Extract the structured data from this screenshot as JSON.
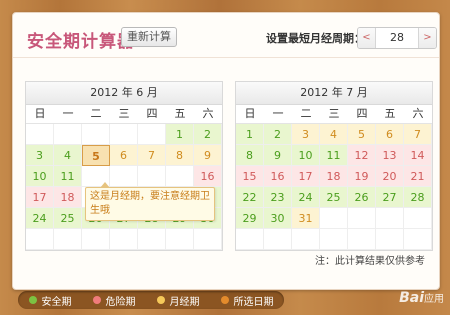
{
  "header": {
    "title": "安全期计算器",
    "recalc_label": "重新计算",
    "setting_label": "设置最短月经周期：",
    "cycle_value": "28",
    "dec_glyph": "<",
    "inc_glyph": ">"
  },
  "weekdays": [
    "日",
    "一",
    "二",
    "三",
    "四",
    "五",
    "六"
  ],
  "calendars": [
    {
      "title": "2012 年 6 月",
      "cells": [
        {
          "d": "",
          "t": "empty"
        },
        {
          "d": "",
          "t": "empty"
        },
        {
          "d": "",
          "t": "empty"
        },
        {
          "d": "",
          "t": "empty"
        },
        {
          "d": "",
          "t": "empty"
        },
        {
          "d": "1",
          "t": "safe"
        },
        {
          "d": "2",
          "t": "safe"
        },
        {
          "d": "3",
          "t": "safe"
        },
        {
          "d": "4",
          "t": "safe"
        },
        {
          "d": "5",
          "t": "selected"
        },
        {
          "d": "6",
          "t": "period"
        },
        {
          "d": "7",
          "t": "period"
        },
        {
          "d": "8",
          "t": "period"
        },
        {
          "d": "9",
          "t": "period"
        },
        {
          "d": "10",
          "t": "safe"
        },
        {
          "d": "11",
          "t": "safe"
        },
        {
          "d": "",
          "t": "empty"
        },
        {
          "d": "",
          "t": "empty"
        },
        {
          "d": "",
          "t": "empty"
        },
        {
          "d": "",
          "t": "empty"
        },
        {
          "d": "16",
          "t": "danger"
        },
        {
          "d": "17",
          "t": "danger"
        },
        {
          "d": "18",
          "t": "danger"
        },
        {
          "d": "",
          "t": "empty"
        },
        {
          "d": "",
          "t": "empty"
        },
        {
          "d": "",
          "t": "empty"
        },
        {
          "d": "",
          "t": "empty"
        },
        {
          "d": "23",
          "t": "safe"
        },
        {
          "d": "24",
          "t": "safe"
        },
        {
          "d": "25",
          "t": "safe"
        },
        {
          "d": "26",
          "t": "safe"
        },
        {
          "d": "27",
          "t": "safe"
        },
        {
          "d": "28",
          "t": "safe"
        },
        {
          "d": "29",
          "t": "safe"
        },
        {
          "d": "30",
          "t": "safe"
        },
        {
          "d": "",
          "t": "empty"
        },
        {
          "d": "",
          "t": "empty"
        },
        {
          "d": "",
          "t": "empty"
        },
        {
          "d": "",
          "t": "empty"
        },
        {
          "d": "",
          "t": "empty"
        },
        {
          "d": "",
          "t": "empty"
        },
        {
          "d": "",
          "t": "empty"
        }
      ]
    },
    {
      "title": "2012 年 7 月",
      "cells": [
        {
          "d": "1",
          "t": "safe"
        },
        {
          "d": "2",
          "t": "safe"
        },
        {
          "d": "3",
          "t": "period"
        },
        {
          "d": "4",
          "t": "period"
        },
        {
          "d": "5",
          "t": "period"
        },
        {
          "d": "6",
          "t": "period"
        },
        {
          "d": "7",
          "t": "period"
        },
        {
          "d": "8",
          "t": "safe"
        },
        {
          "d": "9",
          "t": "safe"
        },
        {
          "d": "10",
          "t": "safe"
        },
        {
          "d": "11",
          "t": "safe"
        },
        {
          "d": "12",
          "t": "danger"
        },
        {
          "d": "13",
          "t": "danger"
        },
        {
          "d": "14",
          "t": "danger"
        },
        {
          "d": "15",
          "t": "danger"
        },
        {
          "d": "16",
          "t": "danger"
        },
        {
          "d": "17",
          "t": "danger"
        },
        {
          "d": "18",
          "t": "danger"
        },
        {
          "d": "19",
          "t": "danger"
        },
        {
          "d": "20",
          "t": "danger"
        },
        {
          "d": "21",
          "t": "danger"
        },
        {
          "d": "22",
          "t": "safe"
        },
        {
          "d": "23",
          "t": "safe"
        },
        {
          "d": "24",
          "t": "safe"
        },
        {
          "d": "25",
          "t": "safe"
        },
        {
          "d": "26",
          "t": "safe"
        },
        {
          "d": "27",
          "t": "safe"
        },
        {
          "d": "28",
          "t": "safe"
        },
        {
          "d": "29",
          "t": "safe"
        },
        {
          "d": "30",
          "t": "safe"
        },
        {
          "d": "31",
          "t": "period"
        },
        {
          "d": "",
          "t": "empty"
        },
        {
          "d": "",
          "t": "empty"
        },
        {
          "d": "",
          "t": "empty"
        },
        {
          "d": "",
          "t": "empty"
        },
        {
          "d": "",
          "t": "empty"
        },
        {
          "d": "",
          "t": "empty"
        },
        {
          "d": "",
          "t": "empty"
        },
        {
          "d": "",
          "t": "empty"
        },
        {
          "d": "",
          "t": "empty"
        },
        {
          "d": "",
          "t": "empty"
        },
        {
          "d": "",
          "t": "empty"
        }
      ]
    }
  ],
  "tooltip": "这是月经期，要注意经期卫生哦",
  "note": "注：此计算结果仅供参考",
  "legend": [
    {
      "label": "安全期",
      "color": "#7cc242"
    },
    {
      "label": "危险期",
      "color": "#f07c7c"
    },
    {
      "label": "月经期",
      "color": "#f6c95a"
    },
    {
      "label": "所选日期",
      "color": "#e38b2c"
    }
  ],
  "watermark": {
    "brand": "Bai",
    "suffix": "应用"
  }
}
